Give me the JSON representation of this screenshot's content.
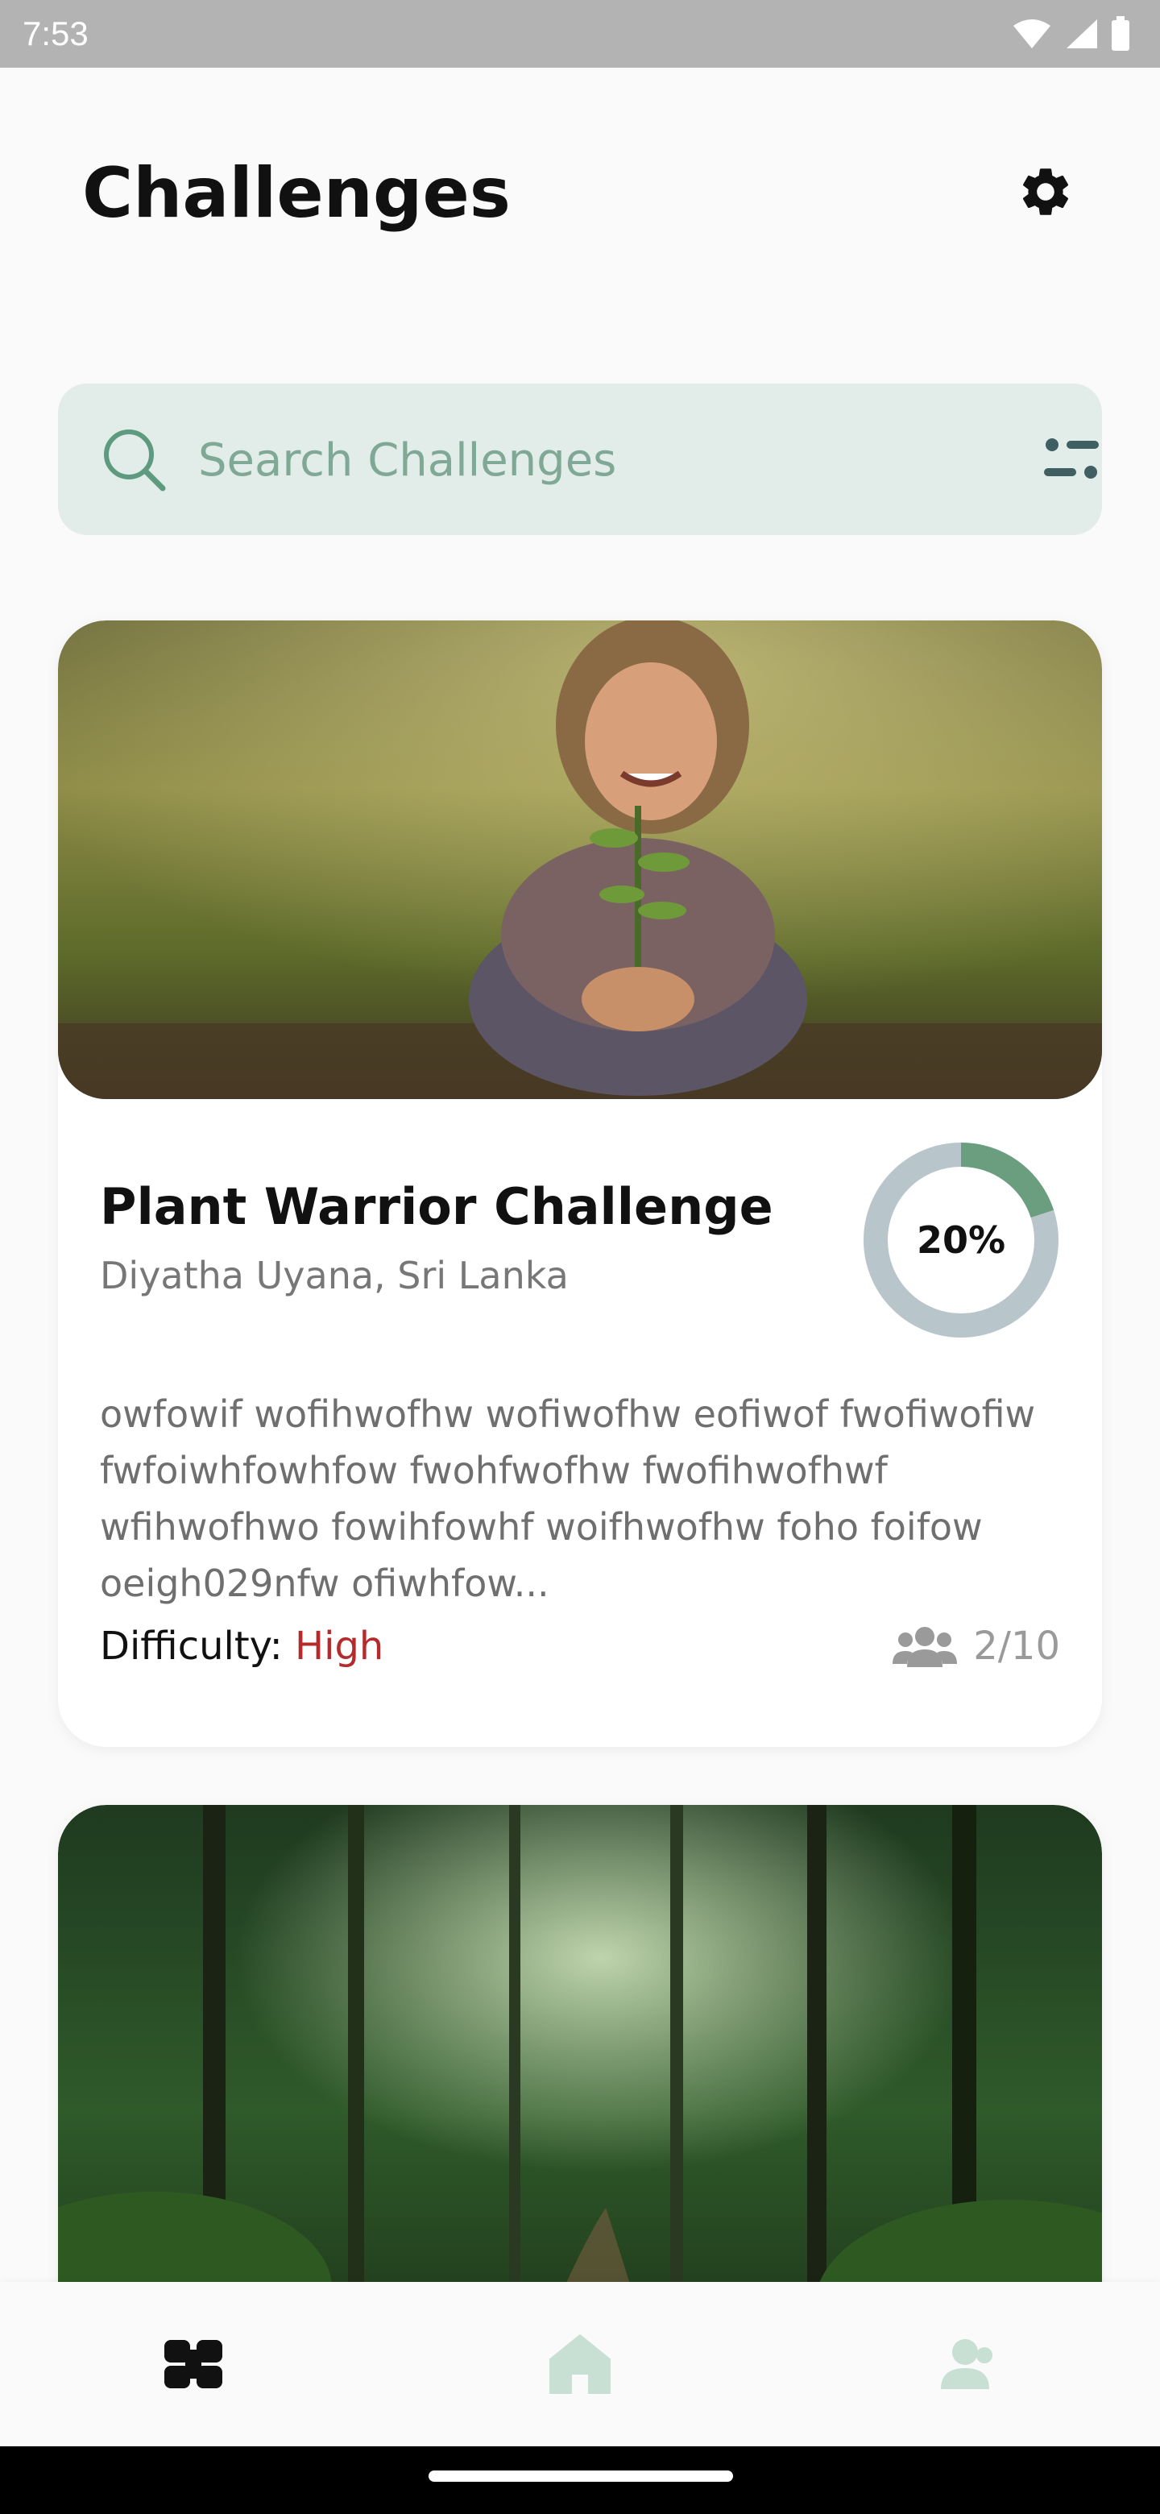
{
  "status_bar": {
    "time": "7:53",
    "icons": [
      "wifi-icon",
      "cellular-icon",
      "battery-icon"
    ]
  },
  "header": {
    "title": "Challenges",
    "settings_icon": "gear-icon"
  },
  "search": {
    "placeholder": "Search Challenges",
    "value": "",
    "search_icon": "search-icon",
    "filter_icon": "filter-icon",
    "accent_color": "#5e9a80",
    "background_color": "#e2ece8"
  },
  "challenges": [
    {
      "image": "child-planting-seedling-photo",
      "title": "Plant Warrior Challenge",
      "location": "Diyatha Uyana, Sri Lanka",
      "progress": 20,
      "progress_label": "20%",
      "description": "owfowif wofihwofhw wofiwofhw eofiwof fwofiwofiw fwfoiwhfowhfow fwohfwofhw fwofihwofhwf wfihwofhwo fowihfowhf woifhwofhw foho foifow oeigh029nfw ofiwhfow...",
      "difficulty_label": "Difficulty:",
      "difficulty_value": "High",
      "participants": "2/10",
      "participants_icon": "group-icon",
      "progress_color": "#6b9e7f",
      "progress_track_color": "#b8c6cc",
      "difficulty_color": "#b52a2a"
    },
    {
      "image": "rainforest-path-photo"
    }
  ],
  "bottom_nav": {
    "items": [
      {
        "icon": "challenges-icon",
        "active": true
      },
      {
        "icon": "home-icon",
        "active": false
      },
      {
        "icon": "profile-icon",
        "active": false
      }
    ],
    "active_color": "#111111",
    "inactive_color": "#c8dfd3"
  }
}
